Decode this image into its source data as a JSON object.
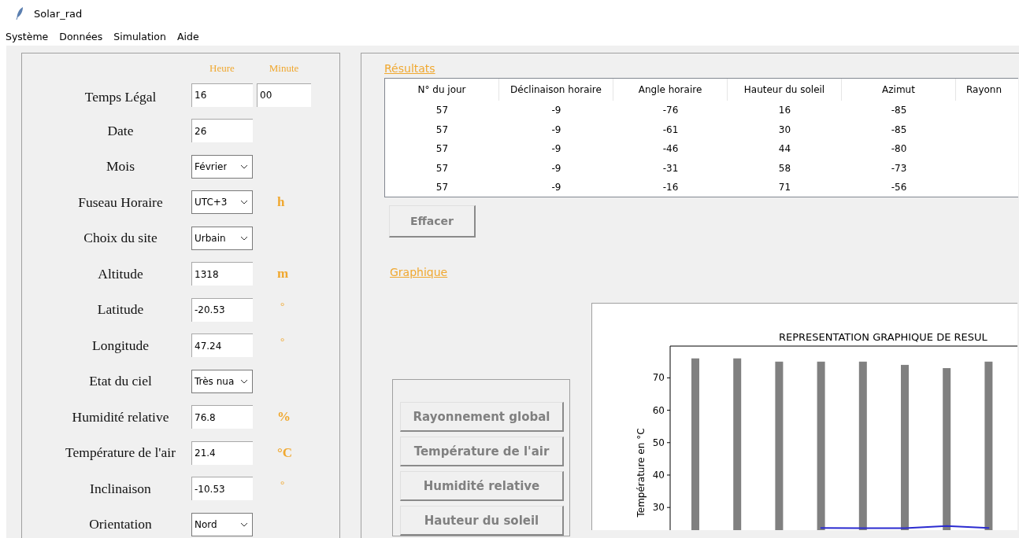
{
  "window": {
    "title": "Solar_rad"
  },
  "menu": [
    "Système",
    "Données",
    "Simulation",
    "Aide"
  ],
  "inputs": {
    "headers": [
      "Heure",
      "Minute"
    ],
    "rows": [
      {
        "label": "Temps Légal",
        "kind": "time",
        "hour": "16",
        "minute": "00"
      },
      {
        "label": "Date",
        "kind": "entry",
        "value": "26"
      },
      {
        "label": "Mois",
        "kind": "dropdown",
        "value": "Février"
      },
      {
        "label": "Fuseau Horaire",
        "kind": "dropdown",
        "value": "UTC+3",
        "unit": "h"
      },
      {
        "label": "Choix du site",
        "kind": "dropdown",
        "value": "Urbain"
      },
      {
        "label": "Altitude",
        "kind": "entry",
        "value": "1318",
        "unit": "m"
      },
      {
        "label": "Latitude",
        "kind": "entry",
        "value": "-20.53",
        "unit": "°"
      },
      {
        "label": "Longitude",
        "kind": "entry",
        "value": "47.24",
        "unit": "°"
      },
      {
        "label": "Etat du ciel",
        "kind": "dropdown",
        "value": "Très nua"
      },
      {
        "label": "Humidité relative",
        "kind": "entry",
        "value": "76.8",
        "unit": "%"
      },
      {
        "label": "Température de l'air",
        "kind": "entry",
        "value": "21.4",
        "unit": "°C"
      },
      {
        "label": "Inclinaison",
        "kind": "entry",
        "value": "-10.53",
        "unit": "°"
      },
      {
        "label": "Orientation",
        "kind": "dropdown",
        "value": "Nord"
      }
    ]
  },
  "results": {
    "title": "Résultats",
    "table": {
      "columns": [
        "N° du jour",
        "Déclinaison horaire",
        "Angle horaire",
        "Hauteur du soleil",
        "Azimut",
        "Rayonn"
      ],
      "rows": [
        [
          "57",
          "-9",
          "-76",
          "16",
          "-85"
        ],
        [
          "57",
          "-9",
          "-61",
          "30",
          "-85"
        ],
        [
          "57",
          "-9",
          "-46",
          "44",
          "-80"
        ],
        [
          "57",
          "-9",
          "-31",
          "58",
          "-73"
        ],
        [
          "57",
          "-9",
          "-16",
          "71",
          "-56"
        ]
      ]
    },
    "clear_button": "Effacer"
  },
  "graph": {
    "title": "Graphique",
    "buttons": [
      "Rayonnement global",
      "Température de l'air",
      "Humidité relative",
      "Hauteur du soleil"
    ],
    "chart_data": {
      "type": "bar",
      "title": "REPRESENTATION GRAPHIQUE DE RESUL",
      "ylabel": "Température en °C",
      "yticks": [
        30,
        40,
        50,
        60,
        70
      ],
      "ylim": [
        0,
        79.8
      ],
      "categories": [
        null,
        null,
        null,
        null,
        null,
        null,
        null,
        null
      ],
      "series": [
        {
          "color": "#808080",
          "values": [
            76,
            76,
            75,
            75,
            75,
            74,
            73,
            75
          ]
        },
        {
          "type": "line",
          "color": "#2b2bd0",
          "values": [
            null,
            null,
            null,
            23.7,
            23.6,
            23.6,
            24.3,
            23.7
          ]
        }
      ]
    }
  }
}
